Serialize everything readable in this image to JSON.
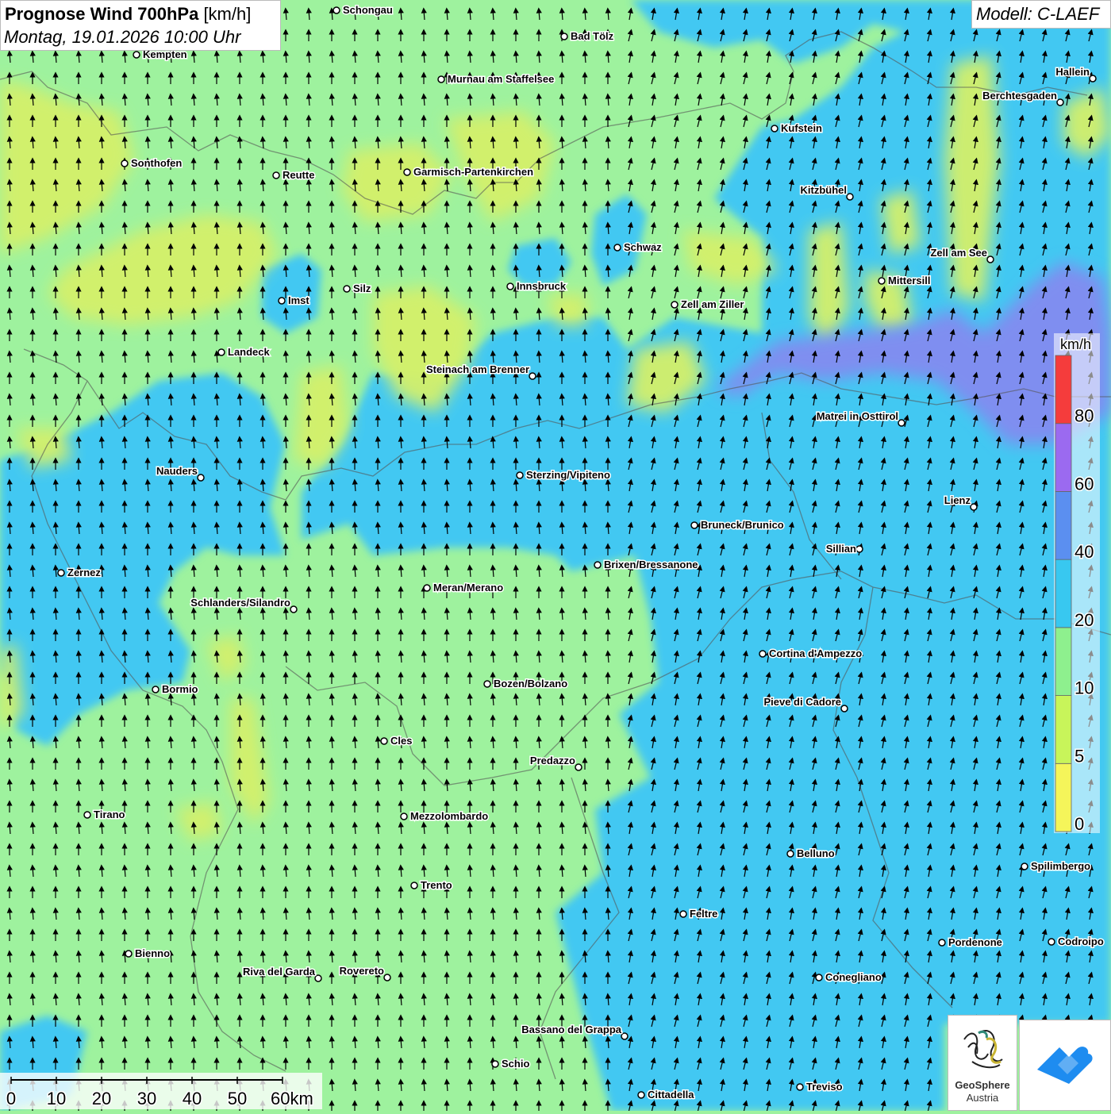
{
  "header": {
    "title_bold": "Prognose Wind 700hPa",
    "title_unit": "[km/h]",
    "datetime": "Montag, 19.01.2026 10:00 Uhr"
  },
  "model": {
    "label": "Modell: C-LAEF"
  },
  "legend": {
    "unit": "km/h",
    "ticks": [
      {
        "label": "80",
        "value": 80
      },
      {
        "label": "60",
        "value": 60
      },
      {
        "label": "40",
        "value": 40
      },
      {
        "label": "20",
        "value": 20
      },
      {
        "label": "10",
        "value": 10
      },
      {
        "label": "5",
        "value": 5
      },
      {
        "label": "0",
        "value": 0
      }
    ],
    "bands": [
      {
        "from": 0,
        "to": 5,
        "color": "#f5f55a"
      },
      {
        "from": 5,
        "to": 10,
        "color": "#c8f55a"
      },
      {
        "from": 10,
        "to": 20,
        "color": "#8ef08e"
      },
      {
        "from": 20,
        "to": 40,
        "color": "#38c8f0"
      },
      {
        "from": 40,
        "to": 60,
        "color": "#5b8ff0"
      },
      {
        "from": 60,
        "to": 80,
        "color": "#9b6af0"
      },
      {
        "from": 80,
        "to": 100,
        "color": "#f53c3c"
      }
    ]
  },
  "scale_bar": {
    "labels": [
      "0",
      "10",
      "20",
      "30",
      "40",
      "50",
      "60km"
    ]
  },
  "cities": [
    {
      "name": "Schongau"
    },
    {
      "name": "Bad Tölz"
    },
    {
      "name": "Kempten"
    },
    {
      "name": "Murnau am Staffelsee"
    },
    {
      "name": "Hallein"
    },
    {
      "name": "Berchtesgaden"
    },
    {
      "name": "Kufstein"
    },
    {
      "name": "Sonthofen"
    },
    {
      "name": "Reutte"
    },
    {
      "name": "Garmisch-Partenkirchen"
    },
    {
      "name": "Kitzbühel"
    },
    {
      "name": "Schwaz"
    },
    {
      "name": "Zell am See"
    },
    {
      "name": "Mittersill"
    },
    {
      "name": "Imst"
    },
    {
      "name": "Silz"
    },
    {
      "name": "Innsbruck"
    },
    {
      "name": "Zell am Ziller"
    },
    {
      "name": "Landeck"
    },
    {
      "name": "Steinach am Brenner"
    },
    {
      "name": "Matrei in Osttirol"
    },
    {
      "name": "Nauders"
    },
    {
      "name": "Sterzing/Vipiteno"
    },
    {
      "name": "Lienz"
    },
    {
      "name": "Bruneck/Brunico"
    },
    {
      "name": "Sillian"
    },
    {
      "name": "Zernez"
    },
    {
      "name": "Brixen/Bressanone"
    },
    {
      "name": "Meran/Merano"
    },
    {
      "name": "Schlanders/Silandro"
    },
    {
      "name": "Cortina d'Ampezzo"
    },
    {
      "name": "Bozen/Bolzano"
    },
    {
      "name": "Bormio"
    },
    {
      "name": "Pieve di Cadore"
    },
    {
      "name": "Cles"
    },
    {
      "name": "Predazzo"
    },
    {
      "name": "Tirano"
    },
    {
      "name": "Mezzolombardo"
    },
    {
      "name": "Belluno"
    },
    {
      "name": "Spilimbergo"
    },
    {
      "name": "Trento"
    },
    {
      "name": "Feltre"
    },
    {
      "name": "Pordenone"
    },
    {
      "name": "Codroipo"
    },
    {
      "name": "Bienno"
    },
    {
      "name": "Riva del Garda"
    },
    {
      "name": "Rovereto"
    },
    {
      "name": "Conegliano"
    },
    {
      "name": "Bassano del Grappa"
    },
    {
      "name": "Schio"
    },
    {
      "name": "Treviso"
    },
    {
      "name": "Cittadella"
    }
  ],
  "logo": {
    "brand": "GeoSphere",
    "country": "Austria",
    "mark_icon": "geosphere-logo-icon",
    "app_icon": "weather-app-icon"
  },
  "colors": {
    "wind_0_5": "#f5f55a",
    "wind_5_10": "#c8f55a",
    "wind_10_20": "#9ef29e",
    "wind_20_40": "#42c8f2",
    "wind_40_60": "#6f8ef0",
    "wind_60_80": "#9b6af0",
    "wind_80_plus": "#f53c3c",
    "app_logo_blue": "#1e8cf0"
  }
}
